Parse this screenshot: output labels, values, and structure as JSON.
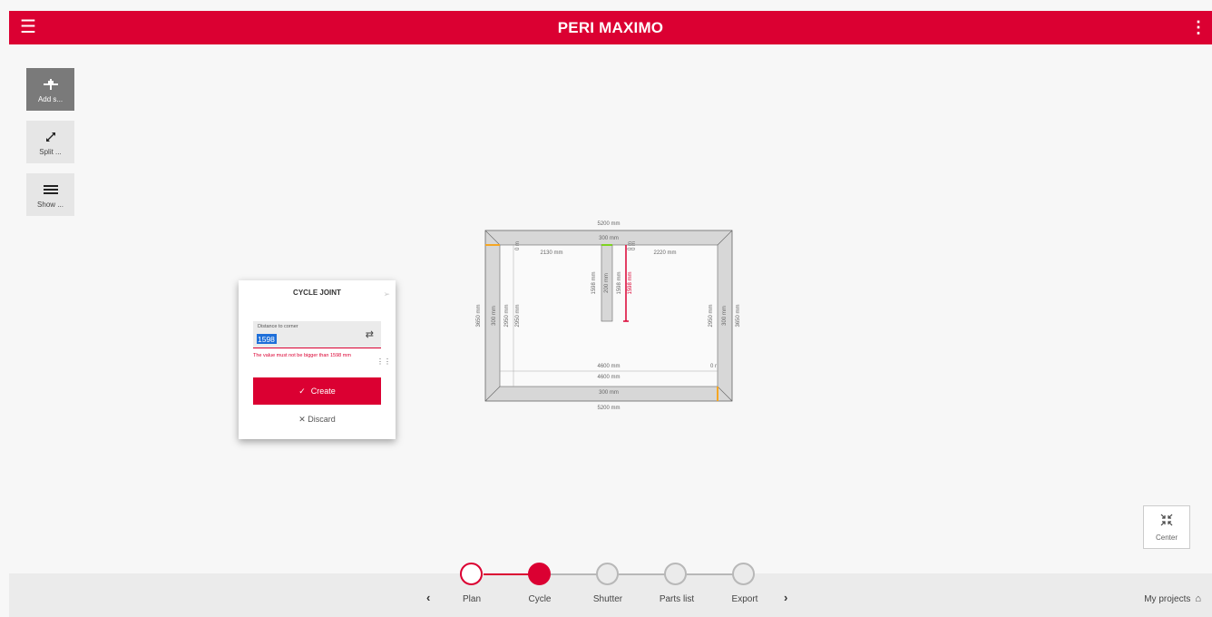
{
  "app": {
    "title": "PERI MAXIMO"
  },
  "tools": [
    {
      "label": "Add s..."
    },
    {
      "label": "Split ..."
    },
    {
      "label": "Show ..."
    }
  ],
  "drawing": {
    "top_outer": "5200 mm",
    "top_inner": "300 mm",
    "top_left": "2130 mm",
    "top_right": "2220 mm",
    "zero_a": "0 m",
    "zero_b": "0 m",
    "zero_c": "0 m",
    "wall_a": "1598 mm",
    "wall_b": "200 mm",
    "wall_c": "1598 mm",
    "wall_d": "1598 mm",
    "left_a": "3650 mm",
    "left_b": "300 mm",
    "left_c": "2950 mm",
    "left_d": "2950 mm",
    "right_a": "2950 mm",
    "right_b": "300 mm",
    "right_c": "3650 mm",
    "inner_a": "4600 mm",
    "inner_b": "4600 mm",
    "zero_d": "0 r",
    "bottom_inner": "300 mm",
    "bottom_outer": "5200 mm"
  },
  "dialog": {
    "title": "CYCLE JOINT",
    "field_label": "Distance to corner",
    "field_value": "1598",
    "error": "The value must not be bigger than 1598 mm",
    "create_label": "Create",
    "discard_label": "Discard"
  },
  "center": {
    "label": "Center"
  },
  "steps": [
    {
      "label": "Plan",
      "state": "done"
    },
    {
      "label": "Cycle",
      "state": "current"
    },
    {
      "label": "Shutter",
      "state": "todo"
    },
    {
      "label": "Parts list",
      "state": "todo"
    },
    {
      "label": "Export",
      "state": "todo"
    }
  ],
  "footer": {
    "my_projects": "My projects"
  },
  "colors": {
    "brand": "#db0032",
    "accent_orange": "#f5a623",
    "accent_green": "#7ed321"
  }
}
